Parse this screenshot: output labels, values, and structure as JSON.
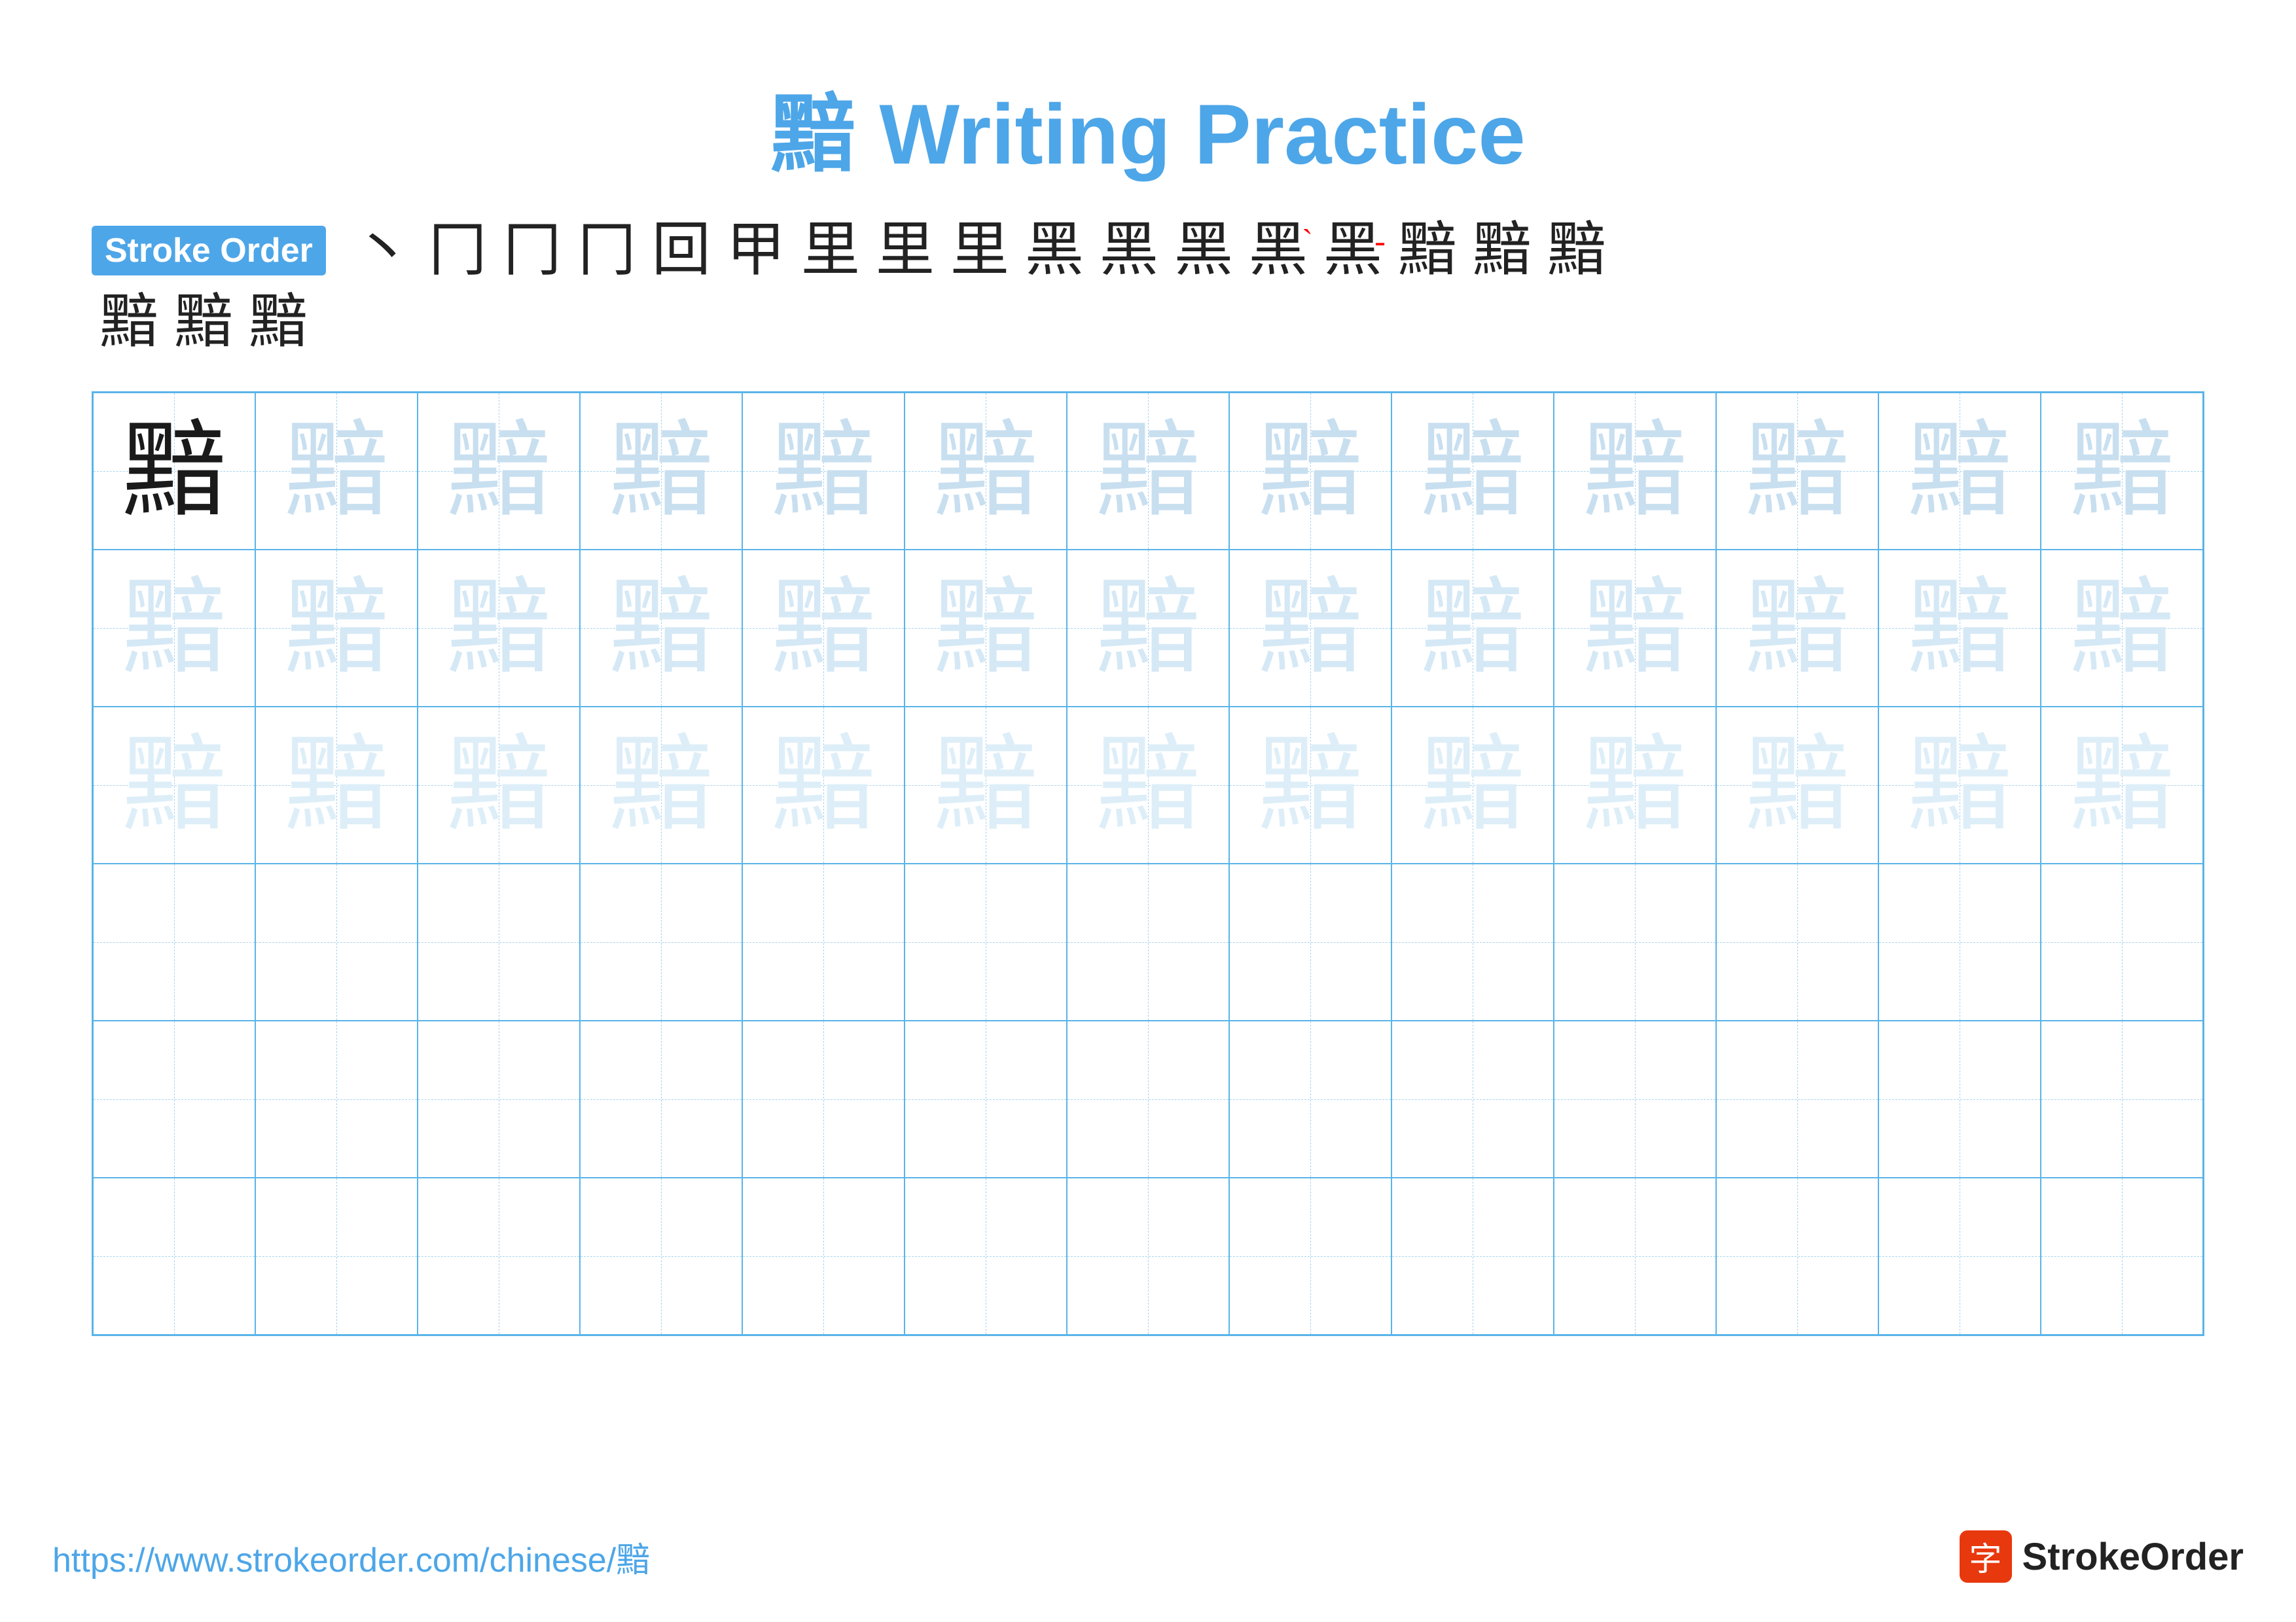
{
  "title": {
    "text": "黯 Writing Practice",
    "char": "黯"
  },
  "stroke_order": {
    "badge_label": "Stroke Order",
    "strokes": [
      "丶",
      "冂",
      "冂",
      "冂",
      "回",
      "甲",
      "里",
      "里",
      "里",
      "黑",
      "黑",
      "黑",
      "黑`",
      "黑-",
      "黯",
      "黯",
      "黯"
    ],
    "row2": [
      "黯",
      "黯",
      "黯"
    ]
  },
  "grid": {
    "char": "黯",
    "rows": 6,
    "cols": 13
  },
  "footer": {
    "url": "https://www.strokeorder.com/chinese/黯",
    "logo_text": "StrokeOrder",
    "logo_icon": "字"
  }
}
